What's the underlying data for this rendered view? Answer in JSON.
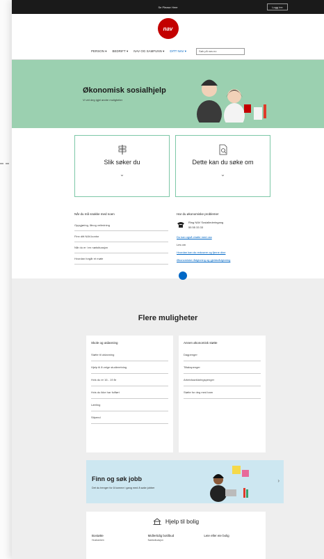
{
  "topbar": {
    "center_label": "Se Please Here",
    "login_label": "Logg inn"
  },
  "logo": {
    "text": "nav"
  },
  "nav": {
    "items": [
      "PERSON",
      "BEDRIFT",
      "NAV OG SAMFUNN",
      "DITT NAV"
    ],
    "search_placeholder": "Søk på nav.no"
  },
  "hero": {
    "title": "Økonomisk sosialhjelp",
    "subtitle": "Vi vet deg igjel andre muligheter"
  },
  "cards": [
    {
      "title": "Slik søker du",
      "icon": "signpost-icon"
    },
    {
      "title": "Dette kan du søke om",
      "icon": "document-search-icon"
    }
  ],
  "contact_left": {
    "heading": "Når du må snakke med noen",
    "links": [
      "Oppgjøring, lånog veiledning",
      "Finn ditt NAV-kontor",
      "Når du er i en nødsituasjon",
      "Hvordan forgår et møte"
    ]
  },
  "contact_right": {
    "heading": "Har du økonomiske problemer",
    "phone_label": "Ring NAV Sosiallederingang",
    "phone_number": "55 55 33 33",
    "link1": "Du kan også chatte med oss",
    "small_label": "Les om",
    "link2": "Hvordan kan du redusere og fjerne dine",
    "link3": "Økonomiske rådgivning og gjeldsrådgivning"
  },
  "flere": {
    "title": "Flere muligheter"
  },
  "skole": {
    "heading": "Skole og utdanning",
    "items": [
      "Støtte til utdanning",
      "Hjelp til å velge studieretning",
      "Hvis du er 16 - 19 år",
      "Hvis du ikke har fullført",
      "Lærling",
      "Stipend"
    ]
  },
  "annen": {
    "heading": "Annen økonomisk støtte",
    "items": [
      "Dagpenger",
      "Tiltakspenger",
      "Arbeidsavklaringspenger",
      "Støtte for deg med barn"
    ]
  },
  "jobb": {
    "title": "Finn og søk jobb",
    "subtitle": "Det du trenger for å komme i gang med å søke jobber"
  },
  "bolig": {
    "title": "Hjelp til bolig",
    "columns": [
      {
        "title": "Bostøtte",
        "sub": "Husbanken"
      },
      {
        "title": "Midlertidig botilbud",
        "sub": "Nødssituasjon"
      },
      {
        "title": "Leie eller eie bolig",
        "sub": ""
      }
    ]
  },
  "colors": {
    "hero_bg": "#9bd0b0",
    "card_border": "#7cc7a6",
    "link": "#0067c5",
    "brand": "#c30000",
    "jobb_bg": "#cde7f1"
  }
}
